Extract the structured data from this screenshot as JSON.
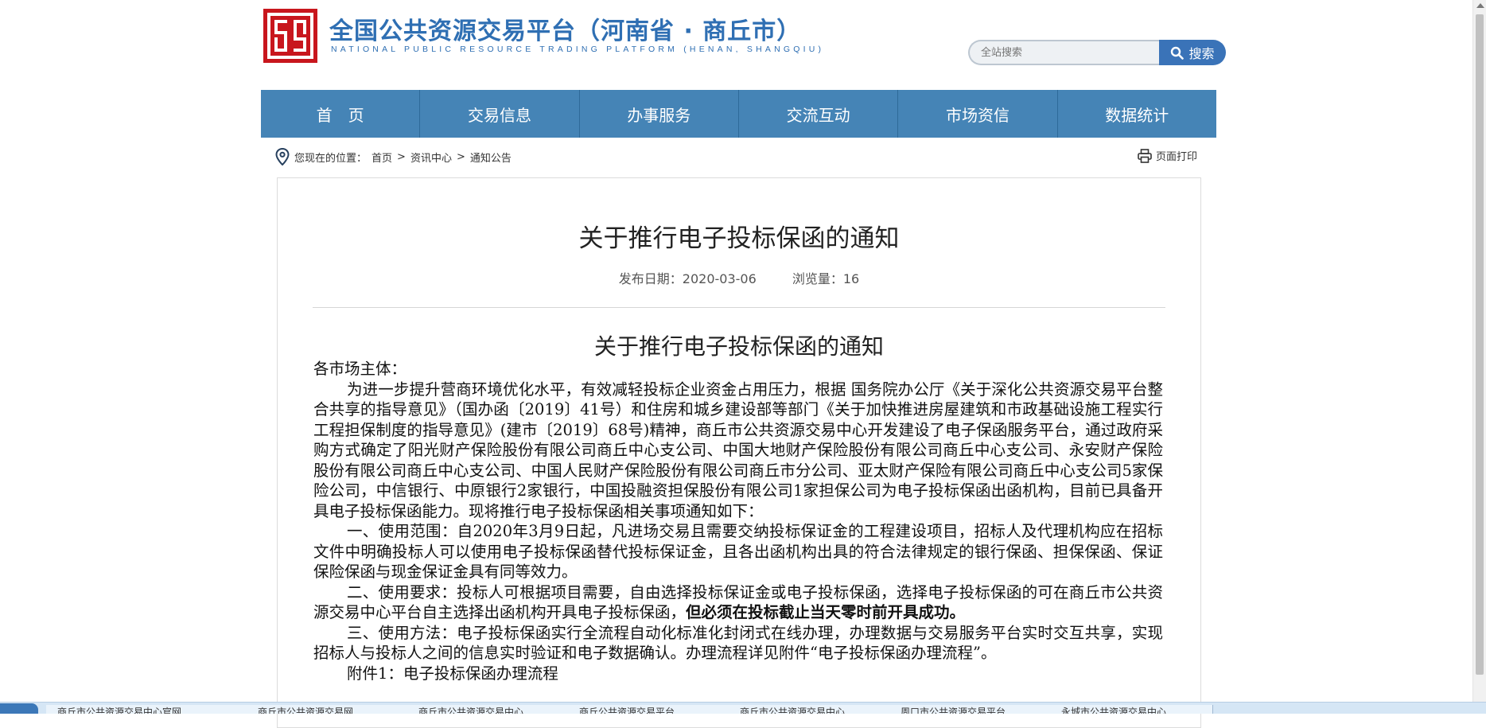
{
  "header": {
    "title": "全国公共资源交易平台（河南省 · 商丘市）",
    "subtitle": "NATIONAL PUBLIC RESOURCE TRADING PLATFORM (HENAN, SHANGQIU)",
    "search_placeholder": "全站搜索",
    "search_button": "搜索"
  },
  "nav": {
    "items": [
      "首　页",
      "交易信息",
      "办事服务",
      "交流互动",
      "市场资信",
      "数据统计"
    ]
  },
  "breadcrumb": {
    "prefix": "您现在的位置：",
    "items": [
      "首页",
      "资讯中心",
      "通知公告"
    ],
    "separator": ">"
  },
  "print_label": "页面打印",
  "article": {
    "title": "关于推行电子投标保函的通知",
    "date_label": "发布日期：",
    "date": "2020-03-06",
    "views_label": "浏览量：",
    "views": "16",
    "body_title": "关于推行电子投标保函的通知",
    "salutation": "各市场主体：",
    "para1": "为进一步提升营商环境优化水平，有效减轻投标企业资金占用压力，根据 国务院办公厅《关于深化公共资源交易平台整合共享的指导意见》（国办函〔2019〕41号）和住房和城乡建设部等部门《关于加快推进房屋建筑和市政基础设施工程实行工程担保制度的指导意见》(建市〔2019〕68号)精神，商丘市公共资源交易中心开发建设了电子保函服务平台，通过政府采购方式确定了阳光财产保险股份有限公司商丘中心支公司、中国大地财产保险股份有限公司商丘中心支公司、永安财产保险股份有限公司商丘中心支公司、中国人民财产保险股份有限公司商丘市分公司、亚太财产保险有限公司商丘中心支公司5家保险公司，中信银行、中原银行2家银行，中国投融资担保股份有限公司1家担保公司为电子投标保函出函机构，目前已具备开具电子投标保函能力。现将推行电子投标保函相关事项通知如下：",
    "para2": "一、使用范围：自2020年3月9日起，凡进场交易且需要交纳投标保证金的工程建设项目，招标人及代理机构应在招标文件中明确投标人可以使用电子投标保函替代投标保证金，且各出函机构出具的符合法律规定的银行保函、担保保函、保证保险保函与现金保证金具有同等效力。",
    "para3_a": "二、使用要求：投标人可根据项目需要，自由选择投标保证金或电子投标保函，选择电子投标保函的可在商丘市公共资源交易中心平台自主选择出函机构开具电子投标保函，",
    "para3_b": "但必须在投标截止当天零时前开具成功。",
    "para4": "三、使用方法：电子投标保函实行全流程自动化标准化封闭式在线办理，办理数据与交易服务平台实时交互共享，实现招标人与投标人之间的信息实时验证和电子数据确认。办理流程详见附件“电子投标保函办理流程”。",
    "attachment": "附件1：电子投标保函办理流程"
  },
  "taskbar": {
    "tabs": [
      "商丘市公共资源交易中心官网",
      "商丘市公共资源交易网",
      "商丘市公共资源交易中心",
      "商丘公共资源交易平台",
      "商丘市公共资源交易中心",
      "周口市公共资源交易平台",
      "永城市公共资源交易中心"
    ]
  },
  "colors": {
    "brand_blue": "#2f6fb3",
    "nav_bg": "#4584b6",
    "logo_red": "#c8161d"
  }
}
